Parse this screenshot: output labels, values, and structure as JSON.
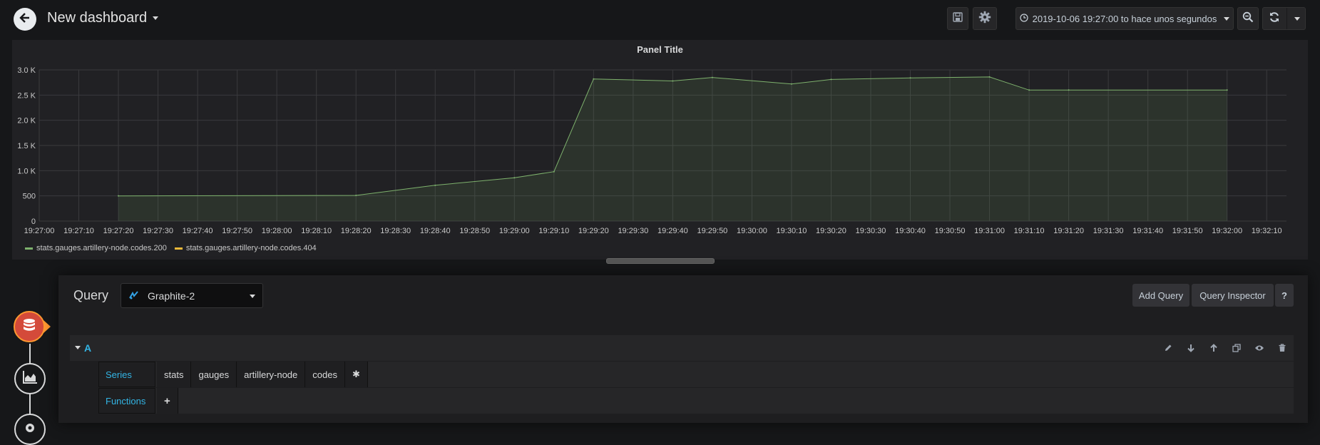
{
  "header": {
    "title": "New dashboard",
    "time_range": "2019-10-06 19:27:00 to hace unos segundos"
  },
  "panel": {
    "title": "Panel Title"
  },
  "chart_data": {
    "type": "area",
    "title": "Panel Title",
    "xlabel": "",
    "ylabel": "",
    "grid": true,
    "legend_position": "bottom-left",
    "xlim": [
      "19:27:00",
      "19:32:15"
    ],
    "ylim": [
      0,
      3000
    ],
    "y_ticks": [
      "0",
      "500",
      "1.0 K",
      "1.5 K",
      "2.0 K",
      "2.5 K",
      "3.0 K"
    ],
    "y_tick_values": [
      0,
      500,
      1000,
      1500,
      2000,
      2500,
      3000
    ],
    "x_ticks": [
      "19:27:00",
      "19:27:10",
      "19:27:20",
      "19:27:30",
      "19:27:40",
      "19:27:50",
      "19:28:00",
      "19:28:10",
      "19:28:20",
      "19:28:30",
      "19:28:40",
      "19:28:50",
      "19:29:00",
      "19:29:10",
      "19:29:20",
      "19:29:30",
      "19:29:40",
      "19:29:50",
      "19:30:00",
      "19:30:10",
      "19:30:20",
      "19:30:30",
      "19:30:40",
      "19:30:50",
      "19:31:00",
      "19:31:10",
      "19:31:20",
      "19:31:30",
      "19:31:40",
      "19:31:50",
      "19:32:00",
      "19:32:10"
    ],
    "series": [
      {
        "name": "stats.gauges.artillery-node.codes.200",
        "color": "#7eb26d",
        "x": [
          "19:27:20",
          "19:28:20",
          "19:28:40",
          "19:29:00",
          "19:29:10",
          "19:29:20",
          "19:29:40",
          "19:29:50",
          "19:30:10",
          "19:30:20",
          "19:30:40",
          "19:31:00",
          "19:31:10",
          "19:31:20",
          "19:32:00"
        ],
        "values": [
          500,
          510,
          710,
          860,
          980,
          2820,
          2780,
          2850,
          2720,
          2810,
          2840,
          2860,
          2600,
          2600,
          2600
        ]
      },
      {
        "name": "stats.gauges.artillery-node.codes.404",
        "color": "#eab839",
        "x": [],
        "values": []
      }
    ]
  },
  "editor": {
    "query_label": "Query",
    "datasource": "Graphite-2",
    "add_query_label": "Add Query",
    "query_inspector_label": "Query Inspector",
    "help_label": "?",
    "query": {
      "letter": "A",
      "series_label": "Series",
      "segments": [
        "stats",
        "gauges",
        "artillery-node",
        "codes",
        "✱"
      ],
      "functions_label": "Functions",
      "add_function": "+"
    }
  },
  "colors": {
    "background": "#161719",
    "panel": "#212124",
    "accent": "#33b5e5",
    "rail_active": "#ff9830"
  }
}
